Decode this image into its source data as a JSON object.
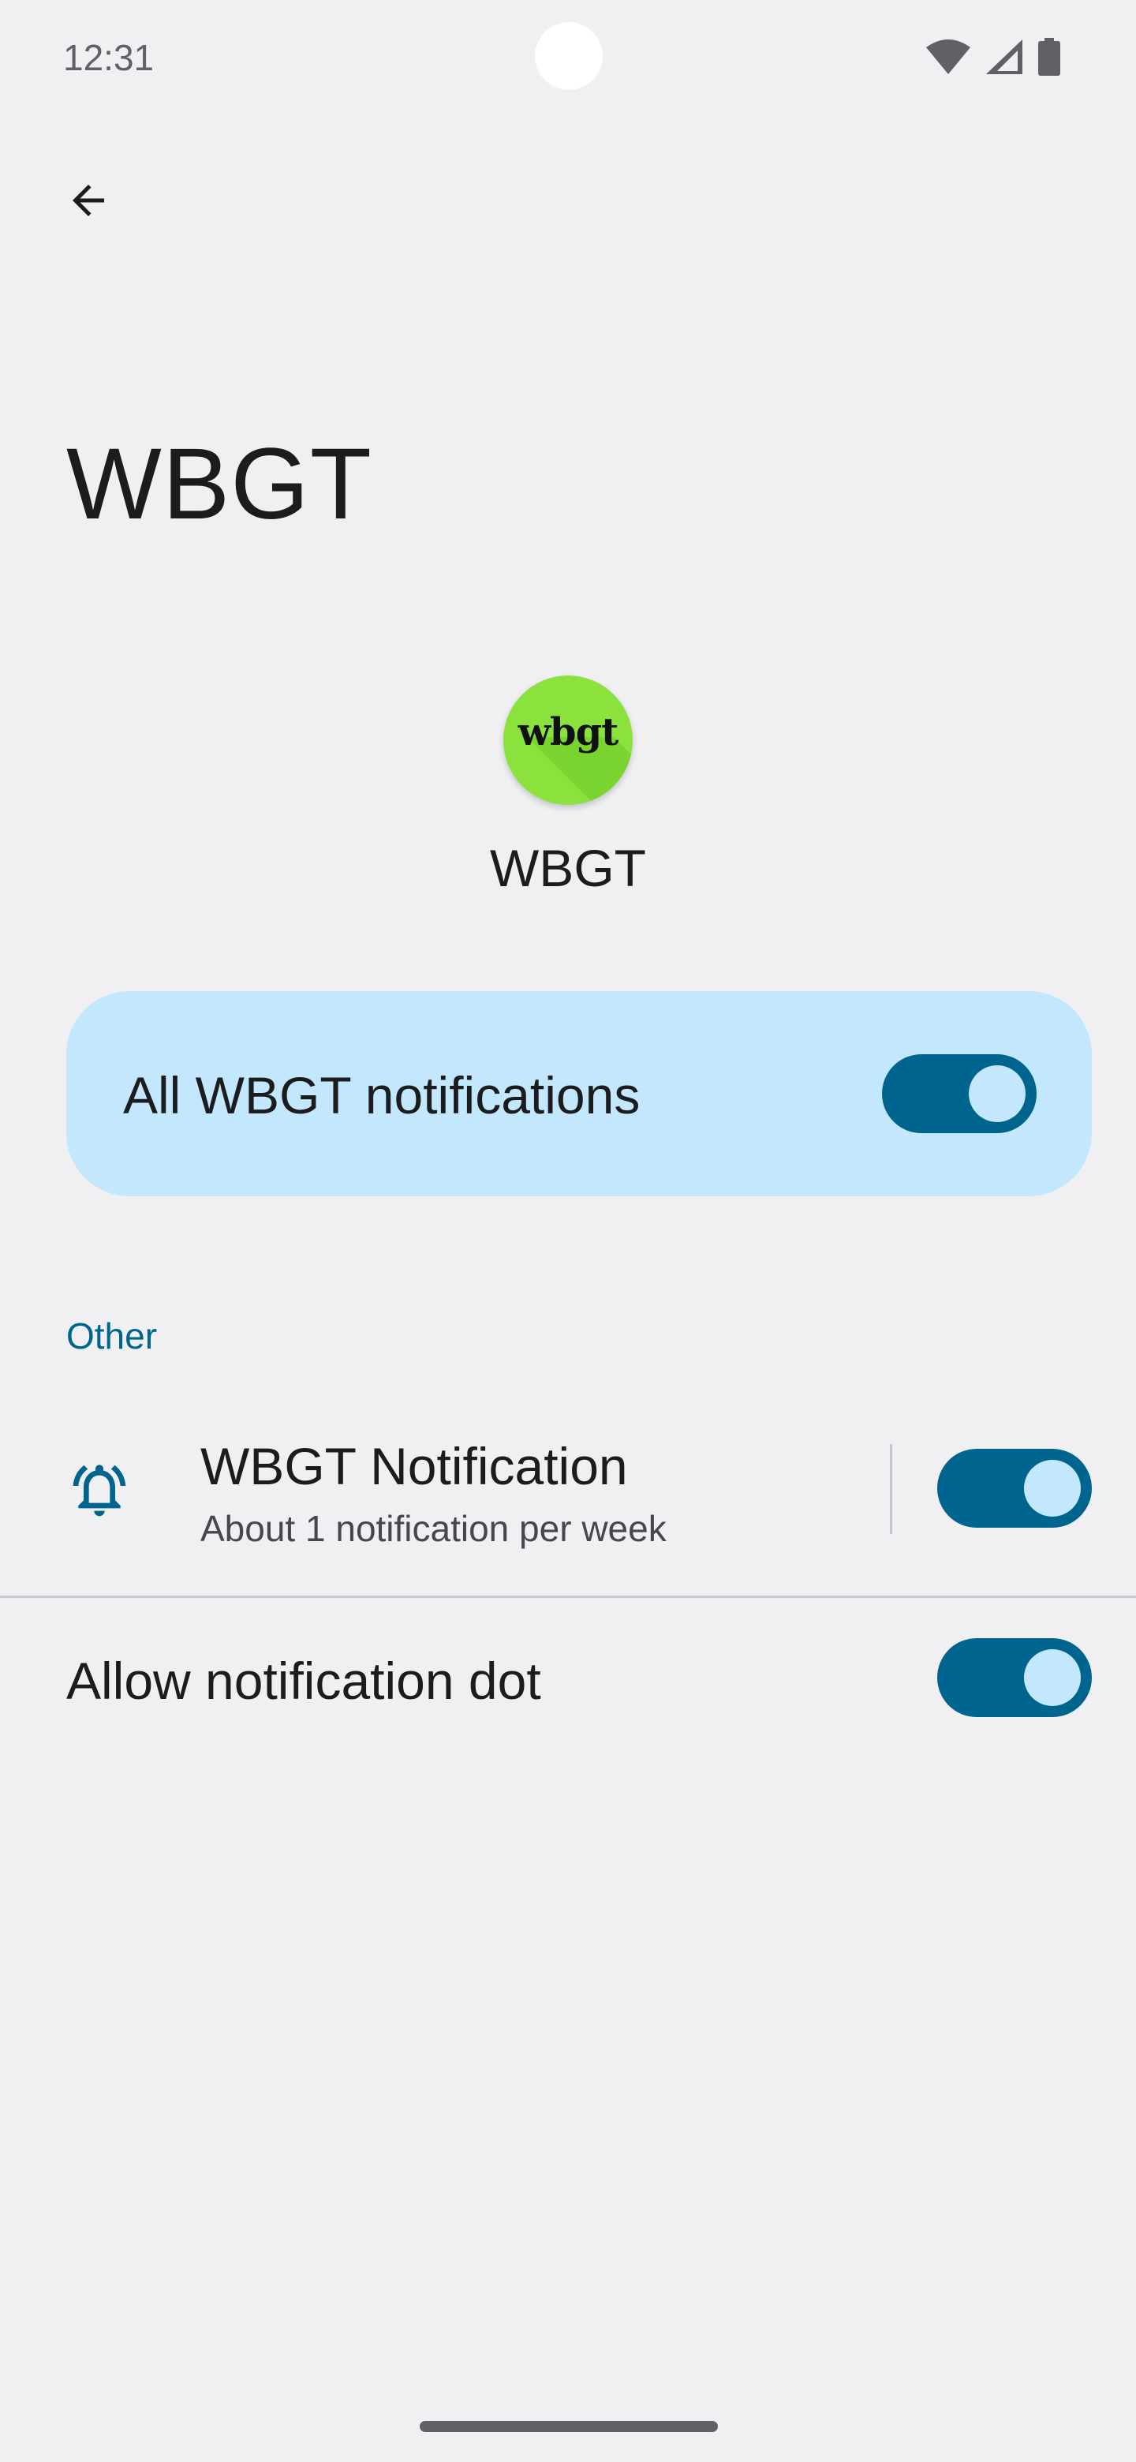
{
  "status_bar": {
    "time": "12:31",
    "icons": [
      "wifi-icon",
      "cell-signal-icon",
      "battery-icon"
    ]
  },
  "header": {
    "back_icon": "arrow-left-icon",
    "title": "WBGT"
  },
  "app": {
    "icon_text": "wbgt",
    "icon_color": "#8be23d",
    "name": "WBGT"
  },
  "all_notifications": {
    "label": "All WBGT notifications",
    "enabled": true
  },
  "sections": [
    {
      "label": "Other",
      "channels": [
        {
          "icon": "bell-icon",
          "title": "WBGT Notification",
          "subtitle": "About 1 notification per week",
          "enabled": true
        }
      ]
    }
  ],
  "notification_dot": {
    "label": "Allow notification dot",
    "enabled": true
  },
  "colors": {
    "accent": "#00658e",
    "card_background": "#c3e7fd",
    "background": "#f0f0f3"
  }
}
